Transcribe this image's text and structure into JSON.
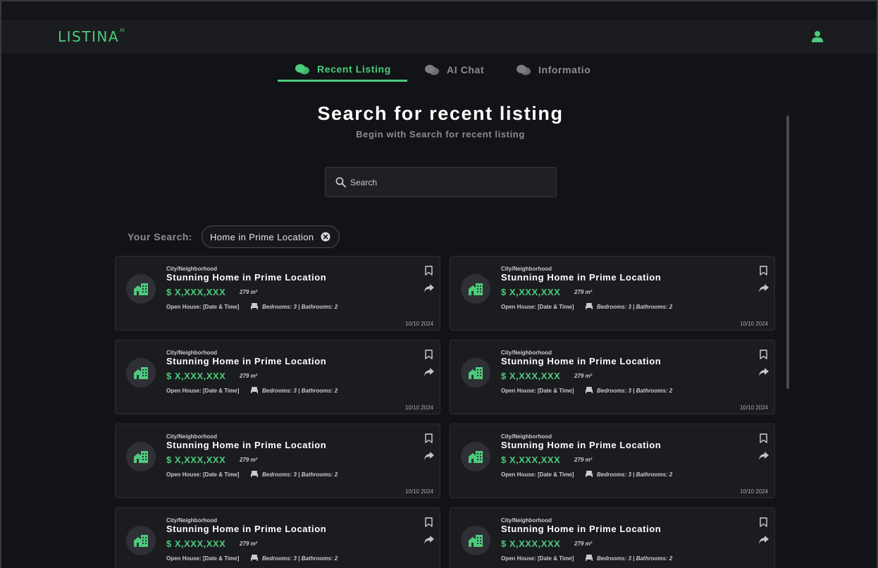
{
  "header": {
    "logo_text": "LISTINA",
    "logo_sup": "AI",
    "accent": "#4ccb7c"
  },
  "tabs": [
    {
      "label": "Recent Listing",
      "icon": "chat-bubbles-icon",
      "active": true
    },
    {
      "label": "AI Chat",
      "icon": "chat-bubbles-icon",
      "active": false
    },
    {
      "label": "Informatio",
      "icon": "chat-bubbles-icon",
      "active": false
    }
  ],
  "hero": {
    "title": "Search for recent listing",
    "subtitle": "Begin with Search for recent listing"
  },
  "search": {
    "placeholder": "Search",
    "value": ""
  },
  "your_search": {
    "label": "Your Search:",
    "chip": "Home in Prime Location"
  },
  "listings": [
    {
      "city": "City/Neighborhood",
      "title": "Stunning Home in Prime Location",
      "price": "$ X,XXX,XXX",
      "area": "279 m²",
      "open_house": "Open House: [Date & Time]",
      "rooms": "Bedrooms: 3 | Bathrooms: 2",
      "date": "10/10 2024"
    },
    {
      "city": "City/Neighborhood",
      "title": "Stunning Home in Prime Location",
      "price": "$ X,XXX,XXX",
      "area": "279 m²",
      "open_house": "Open House: [Date & Time]",
      "rooms": "Bedrooms: 3 | Bathrooms: 2",
      "date": "10/10 2024"
    },
    {
      "city": "City/Neighborhood",
      "title": "Stunning Home in Prime Location",
      "price": "$ X,XXX,XXX",
      "area": "279 m²",
      "open_house": "Open House: [Date & Time]",
      "rooms": "Bedrooms: 3 | Bathrooms: 2",
      "date": "10/10 2024"
    },
    {
      "city": "City/Neighborhood",
      "title": "Stunning Home in Prime Location",
      "price": "$ X,XXX,XXX",
      "area": "279 m²",
      "open_house": "Open House: [Date & Time]",
      "rooms": "Bedrooms: 3 | Bathrooms: 2",
      "date": "10/10 2024"
    },
    {
      "city": "City/Neighborhood",
      "title": "Stunning Home in Prime Location",
      "price": "$ X,XXX,XXX",
      "area": "279 m²",
      "open_house": "Open House: [Date & Time]",
      "rooms": "Bedrooms: 3 | Bathrooms: 2",
      "date": "10/10 2024"
    },
    {
      "city": "City/Neighborhood",
      "title": "Stunning Home in Prime Location",
      "price": "$ X,XXX,XXX",
      "area": "279 m²",
      "open_house": "Open House: [Date & Time]",
      "rooms": "Bedrooms: 3 | Bathrooms: 2",
      "date": "10/10 2024"
    },
    {
      "city": "City/Neighborhood",
      "title": "Stunning Home in Prime Location",
      "price": "$ X,XXX,XXX",
      "area": "279 m²",
      "open_house": "Open House: [Date & Time]",
      "rooms": "Bedrooms: 3 | Bathrooms: 2",
      "date": ""
    },
    {
      "city": "City/Neighborhood",
      "title": "Stunning Home in Prime Location",
      "price": "$ X,XXX,XXX",
      "area": "279 m²",
      "open_house": "Open House: [Date & Time]",
      "rooms": "Bedrooms: 3 | Bathrooms: 2",
      "date": ""
    }
  ],
  "colors": {
    "background": "#121317",
    "card": "#1b1c20",
    "accent": "#4ccb7c",
    "muted": "#8c8d92"
  }
}
